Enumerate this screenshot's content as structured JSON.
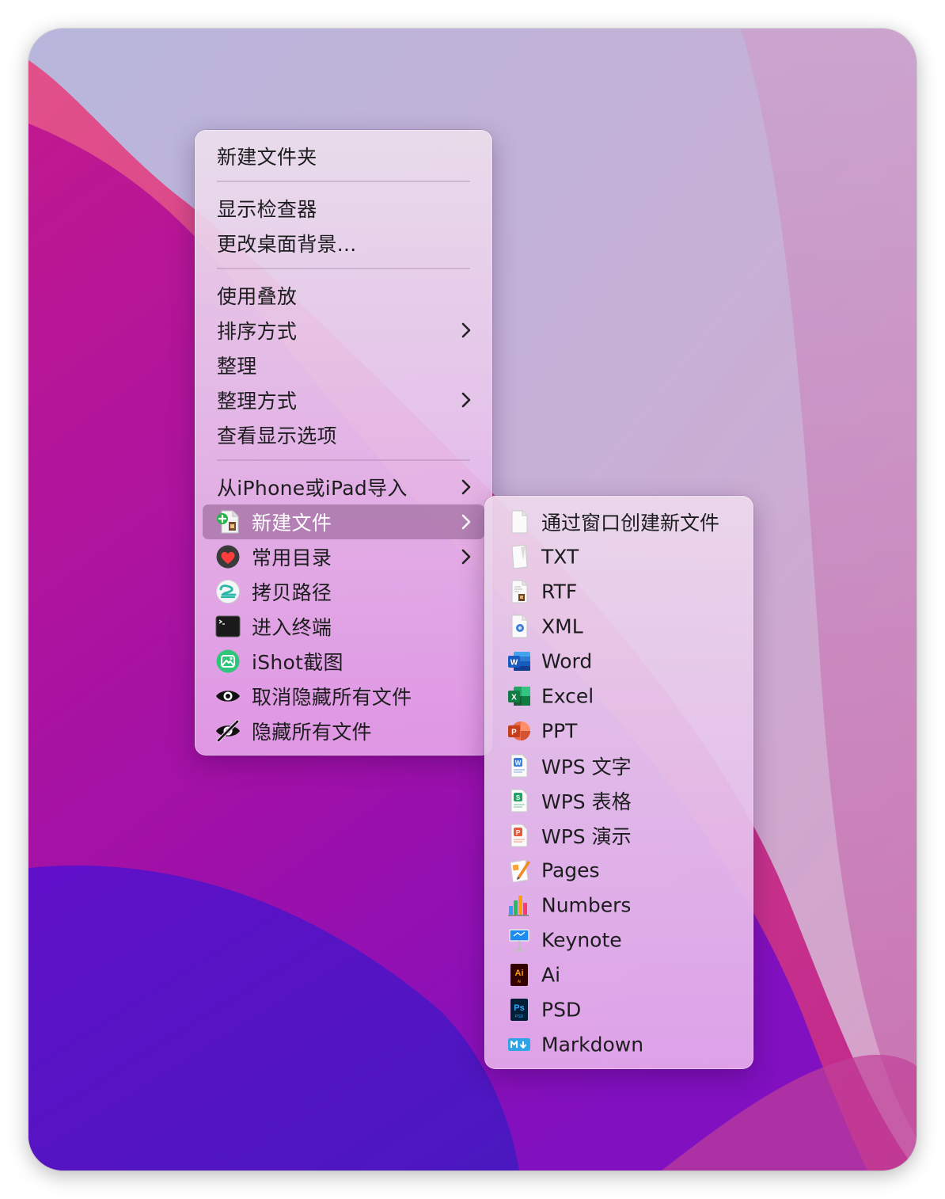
{
  "context_menu": {
    "items": [
      {
        "label": "新建文件夹"
      },
      {
        "label": "显示检查器"
      },
      {
        "label": "更改桌面背景..."
      },
      {
        "label": "使用叠放"
      },
      {
        "label": "排序方式"
      },
      {
        "label": "整理"
      },
      {
        "label": "整理方式"
      },
      {
        "label": "查看显示选项"
      },
      {
        "label": "从iPhone或iPad导入"
      },
      {
        "label": "新建文件"
      },
      {
        "label": "常用目录"
      },
      {
        "label": "拷贝路径"
      },
      {
        "label": "进入终端"
      },
      {
        "label": "iShot截图"
      },
      {
        "label": "取消隐藏所有文件"
      },
      {
        "label": "隐藏所有文件"
      }
    ],
    "highlighted": "新建文件"
  },
  "submenu": {
    "items": [
      {
        "label": "通过窗口创建新文件",
        "icon": "blank-document-icon"
      },
      {
        "label": "TXT",
        "icon": "txt-file-icon"
      },
      {
        "label": "RTF",
        "icon": "rtf-file-icon"
      },
      {
        "label": "XML",
        "icon": "xml-file-icon"
      },
      {
        "label": "Word",
        "icon": "word-icon"
      },
      {
        "label": "Excel",
        "icon": "excel-icon"
      },
      {
        "label": "PPT",
        "icon": "powerpoint-icon"
      },
      {
        "label": "WPS 文字",
        "icon": "wps-writer-icon"
      },
      {
        "label": "WPS 表格",
        "icon": "wps-spreadsheet-icon"
      },
      {
        "label": "WPS 演示",
        "icon": "wps-presentation-icon"
      },
      {
        "label": "Pages",
        "icon": "pages-icon"
      },
      {
        "label": "Numbers",
        "icon": "numbers-icon"
      },
      {
        "label": "Keynote",
        "icon": "keynote-icon"
      },
      {
        "label": "Ai",
        "icon": "illustrator-icon"
      },
      {
        "label": "PSD",
        "icon": "photoshop-icon"
      },
      {
        "label": "Markdown",
        "icon": "markdown-icon"
      }
    ]
  },
  "colors": {
    "highlight": "#9a6a9a",
    "word": "#185abd",
    "excel": "#107c41",
    "powerpoint": "#c43e1c",
    "illustrator": "#ff9a00",
    "photoshop": "#31a8ff",
    "markdown": "#2fa4e7"
  }
}
